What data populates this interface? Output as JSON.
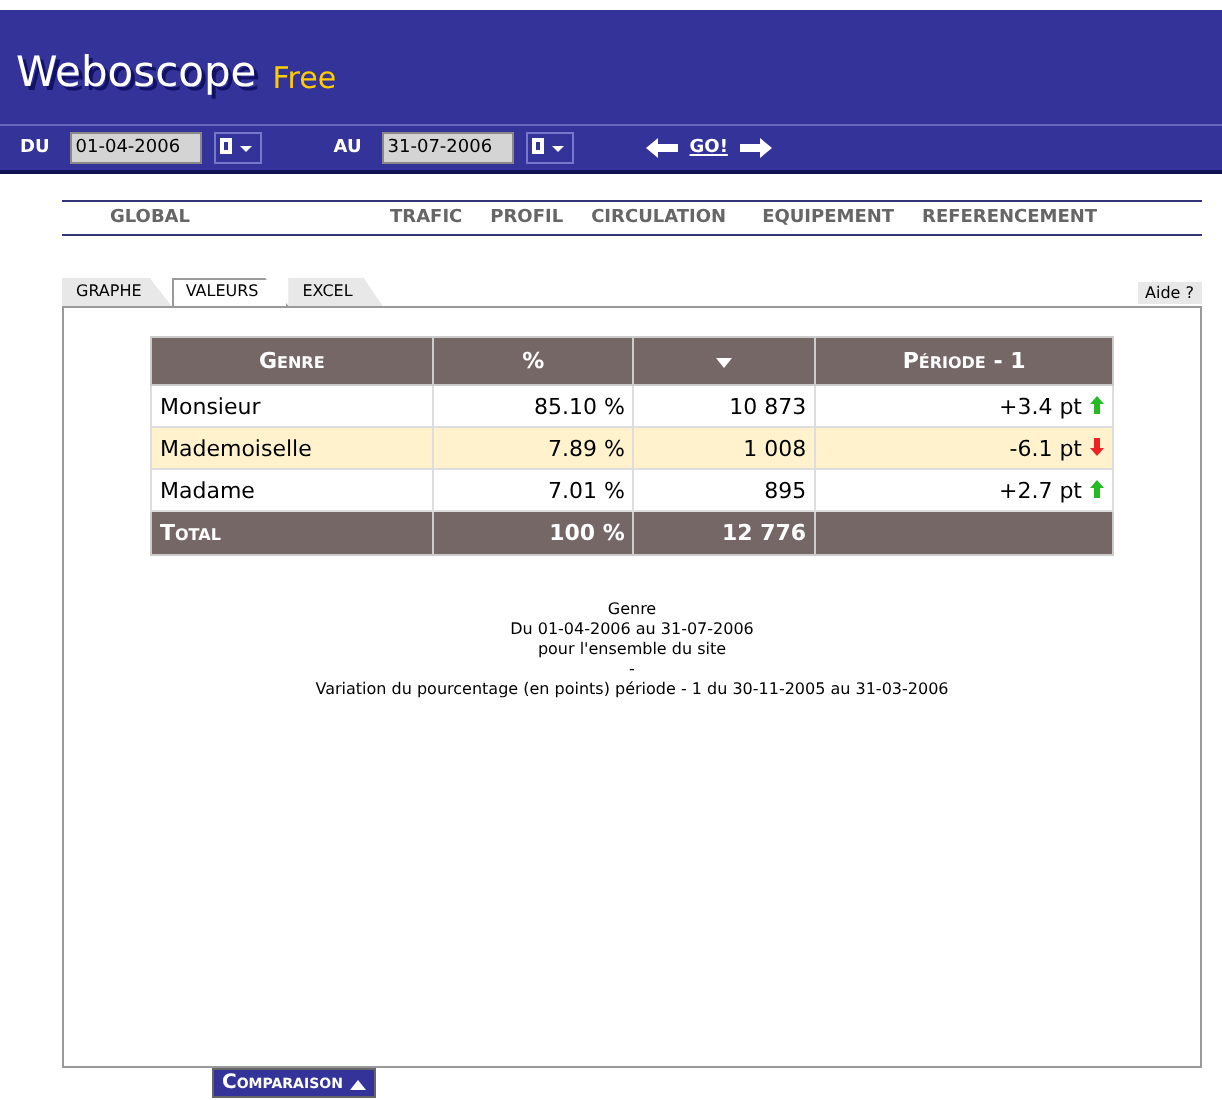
{
  "header": {
    "title": "Weboscope",
    "edition": "Free"
  },
  "dates": {
    "from_label": "DU",
    "from": "01-04-2006",
    "to_label": "AU",
    "to": "31-07-2006",
    "go": "GO!"
  },
  "nav": [
    {
      "label": "GLOBAL"
    },
    {
      "label": "TRAFIC"
    },
    {
      "label": "PROFIL"
    },
    {
      "label": "CIRCULATION"
    },
    {
      "label": "EQUIPEMENT"
    },
    {
      "label": "REFERENCEMENT"
    }
  ],
  "tabs": [
    {
      "label": "GRAPHE",
      "selected": false
    },
    {
      "label": "VALEURS",
      "selected": true
    },
    {
      "label": "EXCEL",
      "selected": false
    }
  ],
  "help": "Aide ?",
  "table": {
    "columns": [
      "Genre",
      "%",
      "",
      "Période - 1"
    ],
    "rows": [
      {
        "cells": [
          "Monsieur",
          "85.10 %",
          "10 873",
          "+3.4 pt"
        ],
        "kind": "up",
        "selected": false
      },
      {
        "cells": [
          "Mademoiselle",
          "7.89 %",
          "1 008",
          "-6.1 pt"
        ],
        "kind": "down",
        "selected": true
      },
      {
        "cells": [
          "Madame",
          "7.01 %",
          "895",
          "+2.7 pt"
        ],
        "kind": "up",
        "selected": false
      }
    ],
    "total": [
      "Total",
      "100 %",
      "12 776"
    ]
  },
  "caption": [
    "Genre",
    "Du 01-04-2006 au 31-07-2006",
    "pour l'ensemble du site",
    "-",
    "Variation du pourcentage (en points) période - 1 du 30-11-2005 au 31-03-2006"
  ],
  "comparison": "Comparaison"
}
